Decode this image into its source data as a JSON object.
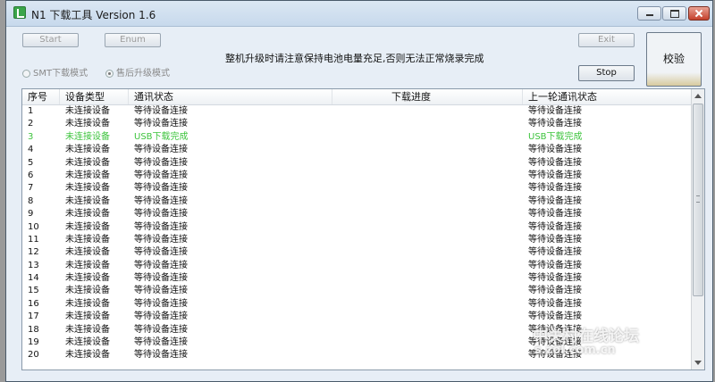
{
  "window": {
    "title": "N1 下载工具 Version 1.6"
  },
  "toolbar": {
    "start_label": "Start",
    "enum_label": "Enum",
    "exit_label": "Exit",
    "stop_label": "Stop",
    "verify_label": "校验"
  },
  "notice": "整机升级时请注意保持电池电量充足,否则无法正常烧录完成",
  "modes": {
    "smt_label": "SMT下载模式",
    "after_sales_label": "售后升级模式",
    "selected": "after_sales"
  },
  "table": {
    "headers": [
      "序号",
      "设备类型",
      "通讯状态",
      "下载进度",
      "上一轮通讯状态"
    ],
    "rows": [
      {
        "no": "1",
        "type": "未连接设备",
        "status": "等待设备连接",
        "last": "等待设备连接"
      },
      {
        "no": "2",
        "type": "未连接设备",
        "status": "等待设备连接",
        "last": "等待设备连接"
      },
      {
        "no": "3",
        "type": "未连接设备",
        "status": "USB下载完成",
        "last": "USB下载完成",
        "state": "done"
      },
      {
        "no": "4",
        "type": "未连接设备",
        "status": "等待设备连接",
        "last": "等待设备连接"
      },
      {
        "no": "5",
        "type": "未连接设备",
        "status": "等待设备连接",
        "last": "等待设备连接"
      },
      {
        "no": "6",
        "type": "未连接设备",
        "status": "等待设备连接",
        "last": "等待设备连接"
      },
      {
        "no": "7",
        "type": "未连接设备",
        "status": "等待设备连接",
        "last": "等待设备连接"
      },
      {
        "no": "8",
        "type": "未连接设备",
        "status": "等待设备连接",
        "last": "等待设备连接"
      },
      {
        "no": "9",
        "type": "未连接设备",
        "status": "等待设备连接",
        "last": "等待设备连接"
      },
      {
        "no": "10",
        "type": "未连接设备",
        "status": "等待设备连接",
        "last": "等待设备连接"
      },
      {
        "no": "11",
        "type": "未连接设备",
        "status": "等待设备连接",
        "last": "等待设备连接"
      },
      {
        "no": "12",
        "type": "未连接设备",
        "status": "等待设备连接",
        "last": "等待设备连接"
      },
      {
        "no": "13",
        "type": "未连接设备",
        "status": "等待设备连接",
        "last": "等待设备连接"
      },
      {
        "no": "14",
        "type": "未连接设备",
        "status": "等待设备连接",
        "last": "等待设备连接"
      },
      {
        "no": "15",
        "type": "未连接设备",
        "status": "等待设备连接",
        "last": "等待设备连接"
      },
      {
        "no": "16",
        "type": "未连接设备",
        "status": "等待设备连接",
        "last": "等待设备连接"
      },
      {
        "no": "17",
        "type": "未连接设备",
        "status": "等待设备连接",
        "last": "等待设备连接"
      },
      {
        "no": "18",
        "type": "未连接设备",
        "status": "等待设备连接",
        "last": "等待设备连接"
      },
      {
        "no": "19",
        "type": "未连接设备",
        "status": "等待设备连接",
        "last": "等待设备连接"
      },
      {
        "no": "20",
        "type": "未连接设备",
        "status": "等待设备连接",
        "last": "等待设备连接"
      }
    ]
  },
  "watermark": {
    "text": "中关村在线论坛",
    "sub": "s.zol.com.cn"
  },
  "colors": {
    "done_text": "#3ec43e",
    "window_bg": "#e7eef6"
  },
  "icons": {
    "app": "app-icon",
    "minimize": "minimize-icon",
    "maximize": "maximize-icon",
    "close": "close-icon"
  }
}
